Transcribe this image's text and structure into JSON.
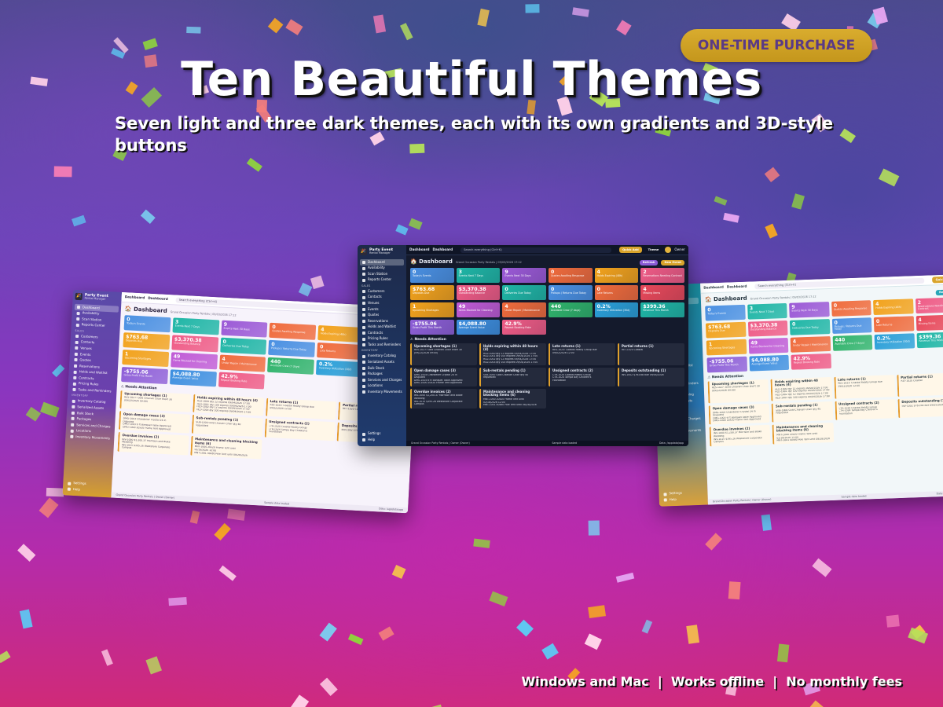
{
  "badge": "ONE-TIME PURCHASE",
  "headline": "Ten Beautiful Themes",
  "subhead": "Seven light and three dark themes, each with its own gradients and 3D-style buttons",
  "footer": "Windows and Mac  |  Works offline  |  No monthly fees",
  "app": {
    "name": "Party Event",
    "subtitle": "Rental Manager",
    "breadcrumb": "Dashboard",
    "breadcrumb_sub": "Dashboard",
    "search_placeholder": "Search everything (Ctrl+K)",
    "quick_add": "Quick Add",
    "theme": "Theme",
    "user": "Owner",
    "refresh": "Refresh",
    "new_event": "New Event",
    "title": "Dashboard",
    "dash_subtitle": "Grand Occasion Party Rentals | 09/03/2026 17:12",
    "sections": {
      "sales": "SALES",
      "inventory": "INVENTORY"
    },
    "nav": [
      {
        "label": "Dashboard",
        "section": "top",
        "active": true
      },
      {
        "label": "Availability",
        "section": "top"
      },
      {
        "label": "Scan Station",
        "section": "top"
      },
      {
        "label": "Reports Center",
        "section": "top"
      },
      {
        "label": "Customers",
        "section": "sales"
      },
      {
        "label": "Contacts",
        "section": "sales"
      },
      {
        "label": "Venues",
        "section": "sales"
      },
      {
        "label": "Events",
        "section": "sales"
      },
      {
        "label": "Quotes",
        "section": "sales"
      },
      {
        "label": "Reservations",
        "section": "sales"
      },
      {
        "label": "Holds and Waitlist",
        "section": "sales"
      },
      {
        "label": "Contracts",
        "section": "sales"
      },
      {
        "label": "Pricing Rules",
        "section": "sales"
      },
      {
        "label": "Tasks and Reminders",
        "section": "sales"
      },
      {
        "label": "Inventory Catalog",
        "section": "inventory"
      },
      {
        "label": "Serialized Assets",
        "section": "inventory"
      },
      {
        "label": "Bulk Stock",
        "section": "inventory"
      },
      {
        "label": "Packages",
        "section": "inventory"
      },
      {
        "label": "Services and Charges",
        "section": "inventory"
      },
      {
        "label": "Locations",
        "section": "inventory"
      },
      {
        "label": "Inventory Movements",
        "section": "inventory"
      },
      {
        "label": "Settings",
        "section": "bottom"
      },
      {
        "label": "Help",
        "section": "bottom"
      }
    ],
    "tiles": [
      {
        "value": "0",
        "label": "Today's Events",
        "color": "#4a90e2"
      },
      {
        "value": "3",
        "label": "Events Next 7 Days",
        "color": "#1fb6a6"
      },
      {
        "value": "9",
        "label": "Events Next 30 Days",
        "color": "#9b59d6"
      },
      {
        "value": "0",
        "label": "Quotes Awaiting Response",
        "color": "#f06b3c"
      },
      {
        "value": "4",
        "label": "Holds Expiring (48h)",
        "color": "#f2a21c"
      },
      {
        "value": "2",
        "label": "Reservations Needing Contract",
        "color": "#ef5b86"
      },
      {
        "value": "$763.68",
        "label": "Deposits Due",
        "color": "#f2a21c"
      },
      {
        "value": "$3,370.38",
        "label": "Outstanding Balance",
        "color": "#ef5b86"
      },
      {
        "value": "0",
        "label": "Deliveries Due Today",
        "color": "#1fb6a6"
      },
      {
        "value": "0",
        "label": "Pickups / Returns Due Today",
        "color": "#4a90e2"
      },
      {
        "value": "0",
        "label": "Late Returns",
        "color": "#f06b3c"
      },
      {
        "value": "4",
        "label": "Missing Items",
        "color": "#e8485a"
      },
      {
        "value": "1",
        "label": "Upcoming Shortages",
        "color": "#f2a21c"
      },
      {
        "value": "49",
        "label": "Items Blocked for Cleaning",
        "color": "#c05bd6"
      },
      {
        "value": "4",
        "label": "Under Repair / Maintenance",
        "color": "#f06b3c"
      },
      {
        "value": "440",
        "label": "Available Crew (7 days)",
        "color": "#2fb36b"
      },
      {
        "value": "0.2%",
        "label": "Inventory Utilization (30d)",
        "color": "#2a9fd8"
      },
      {
        "value": "$399.36",
        "label": "Revenue This Month",
        "color": "#1fb6a6"
      },
      {
        "value": "-$755.06",
        "label": "Gross Profit This Month",
        "color": "#8e5fd8"
      },
      {
        "value": "$4,088.80",
        "label": "Average Event Value",
        "color": "#3d8fe0"
      },
      {
        "value": "42.9%",
        "label": "Repeat Booking Rate",
        "color": "#ef5b86"
      }
    ],
    "attention_title": "Needs Attention",
    "cards": [
      {
        "title": "Upcoming shortages (1)",
        "lines": [
          "RES-1027: Gold Chiavari Chair short 30",
          "(09/22/2026 09:00)"
        ]
      },
      {
        "title": "Holds expiring within 48 hours (4)",
        "lines": [
          "HLD-1000 qty 12 expires 09/04/2026 17:00",
          "HLD-1001 qty 100 expires 09/04/2026 17:00",
          "HLD-1002 qty 12 expires 09/04/2026 17:00",
          "HLD-1003 qty 100 expires 09/04/2026 17:00"
        ]
      },
      {
        "title": "Late returns (1)",
        "lines": [
          "RES-1023: Coastal Realty Group due",
          "09/02/2026 12:00"
        ]
      },
      {
        "title": "Partial returns (1)",
        "lines": [
          "RET-1020 Coastal"
        ]
      },
      {
        "title": "Open damage cases (3)",
        "lines": [
          "DMG-1003 Chandelier Crystal 24 In",
          "Disputed",
          "DMG-1003 6 ft Banquet Table Approved",
          "DMG-1000 20x20 Frame Tent Approved"
        ]
      },
      {
        "title": "Sub-rentals pending (1)",
        "lines": [
          "SUB-1000 Gold Chiavari Chair qty 40",
          "requested"
        ]
      },
      {
        "title": "Unsigned contracts (2)",
        "lines": [
          "CTR-1020 Coastal Realty Group",
          "CTR-1024 Tampa Bay Children's",
          "Foundation"
        ]
      },
      {
        "title": "Deposits outstanding (1)",
        "lines": [
          "INV-1002 $763.68 due 09/05/2026"
        ]
      },
      {
        "title": "Overdue invoices (2)",
        "lines": [
          "INV-1000 $1,200.37 Morrison and Blake",
          "Wedding",
          "INV-1015 $395.26 Westshore Corporate",
          "Campus"
        ]
      },
      {
        "title": "Maintenance and cleaning blocking items (6)",
        "lines": [
          "MNT-1000 20x20 Frame Tent until",
          "02/18/2026 12:00",
          "MNT-1001 40x80 Pole Tent until 08/28/2026"
        ]
      }
    ],
    "status_left": "Grand Occasion Party Rentals | Owner (Owner)",
    "status_center": "Sample data loaded",
    "status_right": "Data: /appdata/app"
  }
}
